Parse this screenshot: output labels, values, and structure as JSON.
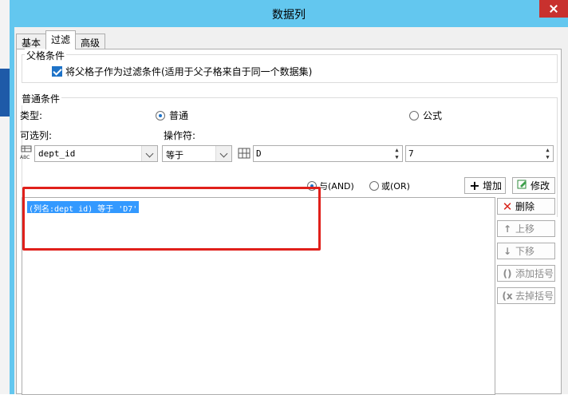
{
  "dialog": {
    "title": "数据列"
  },
  "tabs": [
    "基本",
    "过滤",
    "高级"
  ],
  "parent_group": {
    "title": "父格条件",
    "checkbox_label": "将父格子作为过滤条件(适用于父子格来自于同一个数据集)"
  },
  "normal_group": {
    "title": "普通条件",
    "type_label": "类型:",
    "radio_normal": "普通",
    "radio_formula": "公式",
    "column_label": "可选列:",
    "operator_label": "操作符:",
    "column_value": "dept_id",
    "operator_value": "等于",
    "value1": "D",
    "value2": "7"
  },
  "logic": {
    "and_label": "与(AND)",
    "or_label": "或(OR)",
    "add_label": "增加",
    "edit_label": "修改"
  },
  "conditions": [
    "(列名:dept_id) 等于 'D7'"
  ],
  "side_buttons": {
    "delete": "删除",
    "up": "上移",
    "down": "下移",
    "add_bracket": "添加括号",
    "remove_bracket": "去掉括号"
  },
  "colors": {
    "titlebar": "#63c7ef",
    "close": "#c8312e",
    "selection": "#3399ff",
    "highlight": "#e0201b"
  }
}
